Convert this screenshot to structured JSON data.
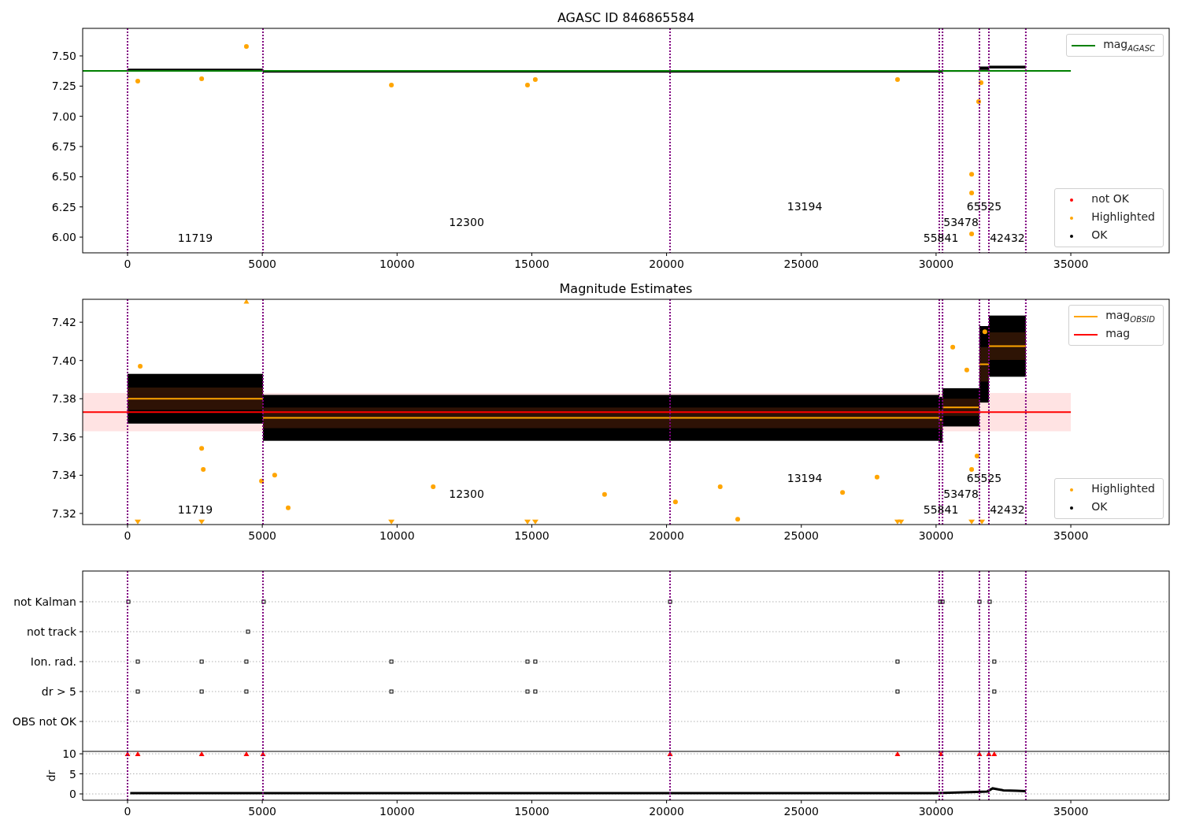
{
  "agasc_panel": {
    "chart_data": {
      "type": "scatter",
      "title": "AGASC ID 846865584",
      "xlim": [
        -1665,
        38650
      ],
      "ylim": [
        5.87,
        7.728
      ],
      "xticks": [
        {
          "value": 0,
          "label": "0"
        },
        {
          "value": 5000,
          "label": "5000"
        },
        {
          "value": 10000,
          "label": "10000"
        },
        {
          "value": 15000,
          "label": "15000"
        },
        {
          "value": 20000,
          "label": "20000"
        },
        {
          "value": 25000,
          "label": "25000"
        },
        {
          "value": 30000,
          "label": "30000"
        },
        {
          "value": 35000,
          "label": "35000"
        }
      ],
      "yticks": [
        {
          "value": 6.0,
          "label": "6.00"
        },
        {
          "value": 6.25,
          "label": "6.25"
        },
        {
          "value": 6.5,
          "label": "6.50"
        },
        {
          "value": 6.75,
          "label": "6.75"
        },
        {
          "value": 7.0,
          "label": "7.00"
        },
        {
          "value": 7.25,
          "label": "7.25"
        },
        {
          "value": 7.5,
          "label": "7.50"
        }
      ],
      "series": [
        {
          "type": "line",
          "color": "#008000",
          "x": [
            -1665,
            35000
          ],
          "values": [
            7.375,
            7.375
          ]
        },
        {
          "type": "scatter",
          "marker": "circle",
          "color": "#ffa500",
          "x": [
            4410,
            380,
            2750,
            9790,
            14840,
            15130,
            28570,
            31320,
            31320,
            31320,
            31580,
            31670
          ],
          "values": [
            7.578,
            7.291,
            7.311,
            7.258,
            7.258,
            7.304,
            7.304,
            6.521,
            6.365,
            6.026,
            7.121,
            7.278
          ]
        }
      ],
      "ref_lines": [
        {
          "axis": "x",
          "value": 0,
          "color": "#800080"
        },
        {
          "axis": "x",
          "value": 5025,
          "color": "#800080"
        },
        {
          "axis": "x",
          "value": 20130,
          "color": "#800080"
        },
        {
          "axis": "x",
          "value": 30120,
          "color": "#800080"
        },
        {
          "axis": "x",
          "value": 30240,
          "color": "#800080"
        },
        {
          "axis": "x",
          "value": 31610,
          "color": "#800080"
        },
        {
          "axis": "x",
          "value": 31960,
          "color": "#800080"
        },
        {
          "axis": "x",
          "value": 33330,
          "color": "#800080"
        }
      ],
      "annotations": [
        "11719",
        "12300",
        "13194",
        "55841",
        "53478",
        "65525",
        "42432"
      ]
    },
    "legend_upper": [
      {
        "label": "mag$_{AGASC}$",
        "kind": "line",
        "color": "#008000"
      }
    ],
    "legend_lower": [
      {
        "label": "not OK",
        "kind": "dot",
        "color": "#ff0000"
      },
      {
        "label": "Highlighted",
        "kind": "dot",
        "color": "#ffa500"
      },
      {
        "label": "OK",
        "kind": "dot",
        "color": "#000000"
      }
    ]
  },
  "estimates_panel": {
    "chart_data": {
      "type": "scatter",
      "title": "Magnitude Estimates",
      "xlim": [
        -1665,
        38650
      ],
      "ylim": [
        7.3142,
        7.432
      ],
      "xticks": [
        {
          "value": 0,
          "label": "0"
        },
        {
          "value": 5000,
          "label": "5000"
        },
        {
          "value": 10000,
          "label": "10000"
        },
        {
          "value": 15000,
          "label": "15000"
        },
        {
          "value": 20000,
          "label": "20000"
        },
        {
          "value": 25000,
          "label": "25000"
        },
        {
          "value": 30000,
          "label": "30000"
        },
        {
          "value": 35000,
          "label": "35000"
        }
      ],
      "yticks": [
        {
          "value": 7.32,
          "label": "7.32"
        },
        {
          "value": 7.34,
          "label": "7.34"
        },
        {
          "value": 7.36,
          "label": "7.36"
        },
        {
          "value": 7.38,
          "label": "7.38"
        },
        {
          "value": 7.4,
          "label": "7.40"
        },
        {
          "value": 7.42,
          "label": "7.42"
        }
      ],
      "bands": [
        {
          "axis": "y",
          "from": 7.363,
          "to": 7.383,
          "color": "#ffe3e3"
        }
      ],
      "series": [
        {
          "type": "line",
          "color": "#ff0000",
          "x": [
            -1665,
            35000
          ],
          "values": [
            7.373,
            7.373
          ]
        },
        {
          "type": "line",
          "color": "#ffa500",
          "x": [
            0,
            5025,
            null,
            5025,
            20130,
            null,
            20130,
            30120,
            null,
            30120,
            30240,
            null,
            30240,
            31610,
            null,
            31610,
            31960,
            null,
            31960,
            33330
          ],
          "values": [
            7.38,
            7.38,
            null,
            7.37,
            7.37,
            null,
            7.37,
            7.37,
            null,
            7.369,
            7.369,
            null,
            7.3755,
            7.3755,
            null,
            7.398,
            7.398,
            null,
            7.4075,
            7.4075
          ]
        },
        {
          "type": "scatter",
          "marker": "circle",
          "color": "#ffa500",
          "x": [
            470,
            2750,
            2810,
            5960,
            4970,
            5460,
            11340,
            17700,
            20330,
            21990,
            22640,
            26530,
            27810,
            31320,
            30620,
            31140,
            31810,
            31520
          ],
          "values": [
            7.397,
            7.354,
            7.343,
            7.323,
            7.337,
            7.34,
            7.334,
            7.33,
            7.326,
            7.334,
            7.317,
            7.331,
            7.339,
            7.343,
            7.407,
            7.395,
            7.415,
            7.35
          ]
        },
        {
          "type": "scatter",
          "marker": "triangle",
          "color": "#ffa500",
          "x": [
            380,
            2750,
            9790,
            14840,
            15130,
            28570,
            28700,
            31320,
            31700
          ],
          "values": [
            7.3155,
            7.3155,
            7.3155,
            7.3155,
            7.3155,
            7.3155,
            7.3155,
            7.3155,
            7.3155
          ]
        },
        {
          "type": "scatter",
          "marker": "triangle",
          "color": "#ffa500",
          "x": [
            4410
          ],
          "values": [
            7.431
          ]
        }
      ],
      "ref_lines": [
        {
          "axis": "x",
          "value": 0,
          "color": "#800080"
        },
        {
          "axis": "x",
          "value": 5025,
          "color": "#800080"
        },
        {
          "axis": "x",
          "value": 20130,
          "color": "#800080"
        },
        {
          "axis": "x",
          "value": 30120,
          "color": "#800080"
        },
        {
          "axis": "x",
          "value": 30240,
          "color": "#800080"
        },
        {
          "axis": "x",
          "value": 31610,
          "color": "#800080"
        },
        {
          "axis": "x",
          "value": 31960,
          "color": "#800080"
        },
        {
          "axis": "x",
          "value": 33330,
          "color": "#800080"
        }
      ],
      "annotations": [
        "11719",
        "12300",
        "13194",
        "55841",
        "53478",
        "65525",
        "42432"
      ]
    },
    "legend_upper": [
      {
        "label": "mag$_{OBSID}$",
        "kind": "line",
        "color": "#ffa500"
      },
      {
        "label": "mag",
        "kind": "line",
        "color": "#ff0000"
      }
    ],
    "legend_lower": [
      {
        "label": "Highlighted",
        "kind": "dot",
        "color": "#ffa500"
      },
      {
        "label": "OK",
        "kind": "dot",
        "color": "#000000"
      }
    ]
  },
  "flags_panel": {
    "chart_data": {
      "type": "scatter",
      "orientation": "horizontal",
      "grid": true,
      "xlim": [
        -1665,
        38650
      ],
      "categories": [
        "not Kalman",
        "not track",
        "Ion. rad.",
        "dr > 5",
        "OBS not OK"
      ],
      "series": [
        {
          "type": "scatter",
          "marker": "square",
          "color": "#000000",
          "values": [
            30,
            4470,
            380,
            380,
            null
          ]
        },
        {
          "type": "scatter",
          "marker": "square",
          "color": "#000000",
          "values": [
            5050,
            null,
            2750,
            2750,
            null
          ]
        },
        {
          "type": "scatter",
          "marker": "square",
          "color": "#000000",
          "values": [
            20130,
            null,
            4410,
            4410,
            null
          ]
        },
        {
          "type": "scatter",
          "marker": "square",
          "color": "#000000",
          "values": [
            30150,
            null,
            9790,
            9790,
            null
          ]
        },
        {
          "type": "scatter",
          "marker": "square",
          "color": "#000000",
          "values": [
            30240,
            null,
            14840,
            14840,
            null
          ]
        },
        {
          "type": "scatter",
          "marker": "square",
          "color": "#000000",
          "values": [
            31610,
            null,
            15130,
            15130,
            null
          ]
        },
        {
          "type": "scatter",
          "marker": "square",
          "color": "#000000",
          "values": [
            31990,
            null,
            28570,
            28570,
            null
          ]
        },
        {
          "type": "scatter",
          "marker": "square",
          "color": "#000000",
          "values": [
            null,
            null,
            32160,
            32160,
            null
          ]
        }
      ],
      "ref_lines": [
        {
          "axis": "x",
          "value": 0,
          "color": "#800080"
        },
        {
          "axis": "x",
          "value": 5025,
          "color": "#800080"
        },
        {
          "axis": "x",
          "value": 20130,
          "color": "#800080"
        },
        {
          "axis": "x",
          "value": 30120,
          "color": "#800080"
        },
        {
          "axis": "x",
          "value": 30240,
          "color": "#800080"
        },
        {
          "axis": "x",
          "value": 31610,
          "color": "#800080"
        },
        {
          "axis": "x",
          "value": 31960,
          "color": "#800080"
        },
        {
          "axis": "x",
          "value": 33330,
          "color": "#800080"
        }
      ]
    }
  },
  "dr_panel": {
    "chart_data": {
      "type": "scatter",
      "grid": true,
      "ylabel": "dr",
      "xlim": [
        -1665,
        38650
      ],
      "ylim": [
        -1.57,
        10.6
      ],
      "xticks": [
        {
          "value": 0,
          "label": "0"
        },
        {
          "value": 5000,
          "label": "5000"
        },
        {
          "value": 10000,
          "label": "10000"
        },
        {
          "value": 15000,
          "label": "15000"
        },
        {
          "value": 20000,
          "label": "20000"
        },
        {
          "value": 25000,
          "label": "25000"
        },
        {
          "value": 30000,
          "label": "30000"
        },
        {
          "value": 35000,
          "label": "35000"
        }
      ],
      "yticks": [
        {
          "value": 0,
          "label": "0"
        },
        {
          "value": 5,
          "label": "5"
        },
        {
          "value": 10,
          "label": "10"
        }
      ],
      "series": [
        {
          "type": "line",
          "color": "#000000",
          "x": [
            100,
            2000,
            4000,
            6000,
            8000,
            10000,
            12000,
            14000,
            16000,
            18000,
            20000,
            22000,
            24000,
            26000,
            28000,
            30000,
            31000,
            31500,
            31900,
            32100,
            32500,
            33000,
            33330
          ],
          "values": [
            0.2,
            0.2,
            0.2,
            0.2,
            0.2,
            0.2,
            0.2,
            0.2,
            0.2,
            0.2,
            0.2,
            0.2,
            0.2,
            0.2,
            0.2,
            0.2,
            0.4,
            0.5,
            0.6,
            1.4,
            0.9,
            0.8,
            0.7
          ]
        },
        {
          "type": "scatter",
          "marker": "triangle",
          "color": "#ff0000",
          "x": [
            0,
            380,
            2750,
            4410,
            5025,
            20130,
            28570,
            30180,
            31610,
            31960,
            32160
          ],
          "values": [
            10,
            10,
            10,
            10,
            10,
            10,
            10,
            10,
            10,
            10,
            10
          ]
        }
      ],
      "ref_lines": [
        {
          "axis": "x",
          "value": 0,
          "color": "#800080"
        },
        {
          "axis": "x",
          "value": 5025,
          "color": "#800080"
        },
        {
          "axis": "x",
          "value": 20130,
          "color": "#800080"
        },
        {
          "axis": "x",
          "value": 30120,
          "color": "#800080"
        },
        {
          "axis": "x",
          "value": 30240,
          "color": "#800080"
        },
        {
          "axis": "x",
          "value": 31610,
          "color": "#800080"
        },
        {
          "axis": "x",
          "value": 31960,
          "color": "#800080"
        },
        {
          "axis": "x",
          "value": 33330,
          "color": "#800080"
        }
      ]
    }
  }
}
